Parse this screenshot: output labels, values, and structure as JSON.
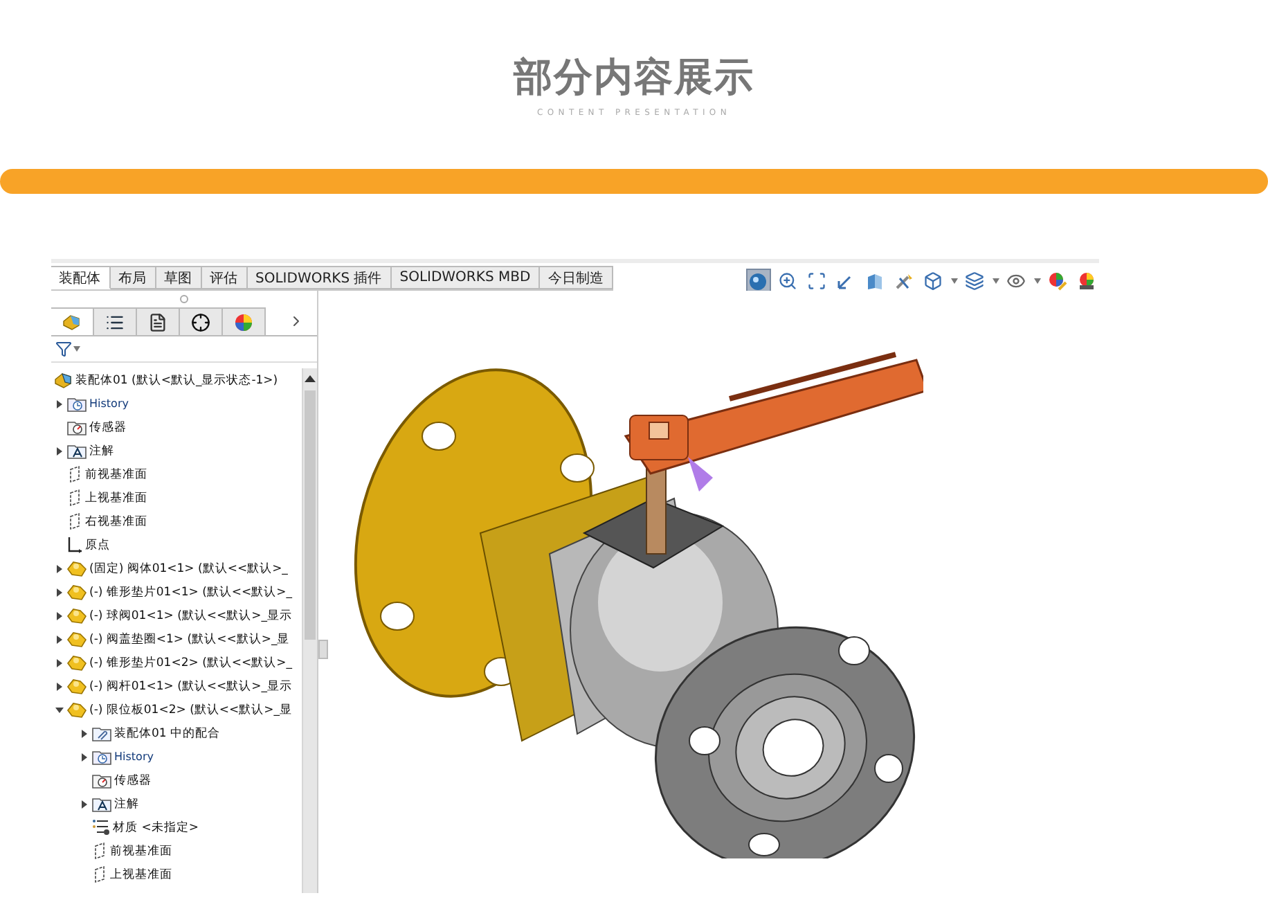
{
  "header": {
    "title": "部分内容展示",
    "subtitle": "CONTENT PRESENTATION"
  },
  "command_tabs": [
    {
      "label": "装配体",
      "selected": true
    },
    {
      "label": "布局",
      "selected": false
    },
    {
      "label": "草图",
      "selected": false
    },
    {
      "label": "评估",
      "selected": false
    },
    {
      "label": "SOLIDWORKS 插件",
      "selected": false
    },
    {
      "label": "SOLIDWORKS MBD",
      "selected": false
    },
    {
      "label": "今日制造",
      "selected": false
    }
  ],
  "panel_tabs": [
    {
      "kind": "feature",
      "selected": true
    },
    {
      "kind": "property",
      "selected": false
    },
    {
      "kind": "config",
      "selected": false
    },
    {
      "kind": "target",
      "selected": false
    },
    {
      "kind": "appearance",
      "selected": false
    }
  ],
  "tree": {
    "label": "装配体01 (默认<默认_显示状态-1>)",
    "kind": "assembly",
    "children": [
      {
        "label": "History",
        "kind": "history",
        "expanded": false
      },
      {
        "label": "传感器",
        "kind": "sensor"
      },
      {
        "label": "注解",
        "kind": "annotation",
        "expanded": false
      },
      {
        "label": "前视基准面",
        "kind": "plane"
      },
      {
        "label": "上视基准面",
        "kind": "plane"
      },
      {
        "label": "右视基准面",
        "kind": "plane"
      },
      {
        "label": "原点",
        "kind": "origin"
      },
      {
        "label": "(固定) 阀体01<1> (默认<<默认>_",
        "kind": "part",
        "expanded": false
      },
      {
        "label": "(-) 锥形垫片01<1> (默认<<默认>_",
        "kind": "part",
        "expanded": false
      },
      {
        "label": "(-) 球阀01<1> (默认<<默认>_显示",
        "kind": "part",
        "expanded": false
      },
      {
        "label": "(-) 阀盖垫圈<1> (默认<<默认>_显",
        "kind": "part",
        "expanded": false
      },
      {
        "label": "(-) 锥形垫片01<2> (默认<<默认>_",
        "kind": "part",
        "expanded": false
      },
      {
        "label": "(-) 阀杆01<1> (默认<<默认>_显示",
        "kind": "part",
        "expanded": false
      },
      {
        "label": "(-) 限位板01<2> (默认<<默认>_显",
        "kind": "part",
        "expanded": true,
        "children": [
          {
            "label": "装配体01 中的配合",
            "kind": "mates",
            "expanded": false
          },
          {
            "label": "History",
            "kind": "history",
            "expanded": false
          },
          {
            "label": "传感器",
            "kind": "sensor"
          },
          {
            "label": "注解",
            "kind": "annotation",
            "expanded": false
          },
          {
            "label": "材质 <未指定>",
            "kind": "material"
          },
          {
            "label": "前视基准面",
            "kind": "plane"
          },
          {
            "label": "上视基准面",
            "kind": "plane"
          }
        ]
      }
    ]
  }
}
